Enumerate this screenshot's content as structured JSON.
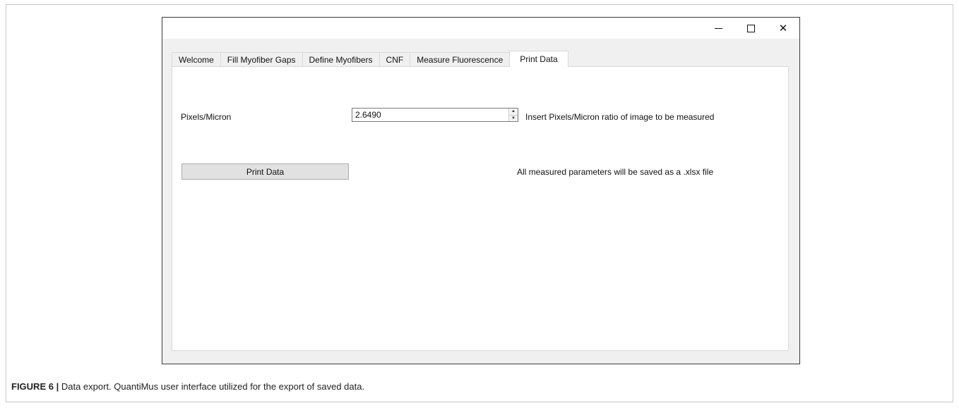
{
  "window": {
    "controls": {
      "minimize": "minimize-icon",
      "maximize": "maximize-icon",
      "close": "close-icon",
      "close_glyph": "✕"
    }
  },
  "tabs": [
    {
      "label": "Welcome"
    },
    {
      "label": "Fill Myofiber Gaps"
    },
    {
      "label": "Define Myofibers"
    },
    {
      "label": "CNF"
    },
    {
      "label": "Measure Fluorescence"
    },
    {
      "label": "Print Data",
      "active": true
    }
  ],
  "panel": {
    "pixels_label": "Pixels/Micron",
    "pixels_value": "2.6490",
    "pixels_hint": "Insert Pixels/Micron ratio of image to be measured",
    "print_button": "Print Data",
    "save_hint": "All measured parameters will be saved as a .xlsx file"
  },
  "caption": {
    "label": "FIGURE 6",
    "separator": "|",
    "text": "Data export. QuantiMus user interface utilized for the export of saved data."
  },
  "colors": {
    "window_bg": "#f0f0f0",
    "panel_bg": "#ffffff",
    "button_bg": "#e1e1e1"
  }
}
